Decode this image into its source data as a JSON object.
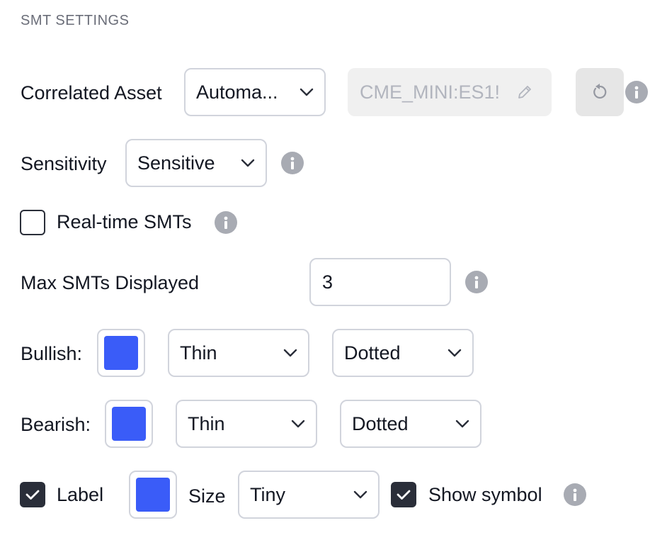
{
  "section_title": "SMT SETTINGS",
  "colors": {
    "swatch_blue": "#3a5cf8",
    "info_icon": "#a8abb3",
    "checkbox_dark": "#2a2e39"
  },
  "correlated_asset": {
    "label": "Correlated Asset",
    "mode_value": "Automa...",
    "symbol_value": "CME_MINI:ES1!",
    "edit_icon": "pencil-icon",
    "reset_icon": "reset-icon"
  },
  "sensitivity": {
    "label": "Sensitivity",
    "value": "Sensitive"
  },
  "realtime": {
    "label": "Real-time SMTs",
    "checked": false
  },
  "max_smts": {
    "label": "Max SMTs Displayed",
    "value": "3"
  },
  "bullish": {
    "label": "Bullish:",
    "color": "#3a5cf8",
    "width_value": "Thin",
    "style_value": "Dotted"
  },
  "bearish": {
    "label": "Bearish:",
    "color": "#3a5cf8",
    "width_value": "Thin",
    "style_value": "Dotted"
  },
  "label_row": {
    "label_checkbox_label": "Label",
    "label_checked": true,
    "color": "#3a5cf8",
    "size_label": "Size",
    "size_value": "Tiny",
    "show_symbol_label": "Show symbol",
    "show_symbol_checked": true
  }
}
